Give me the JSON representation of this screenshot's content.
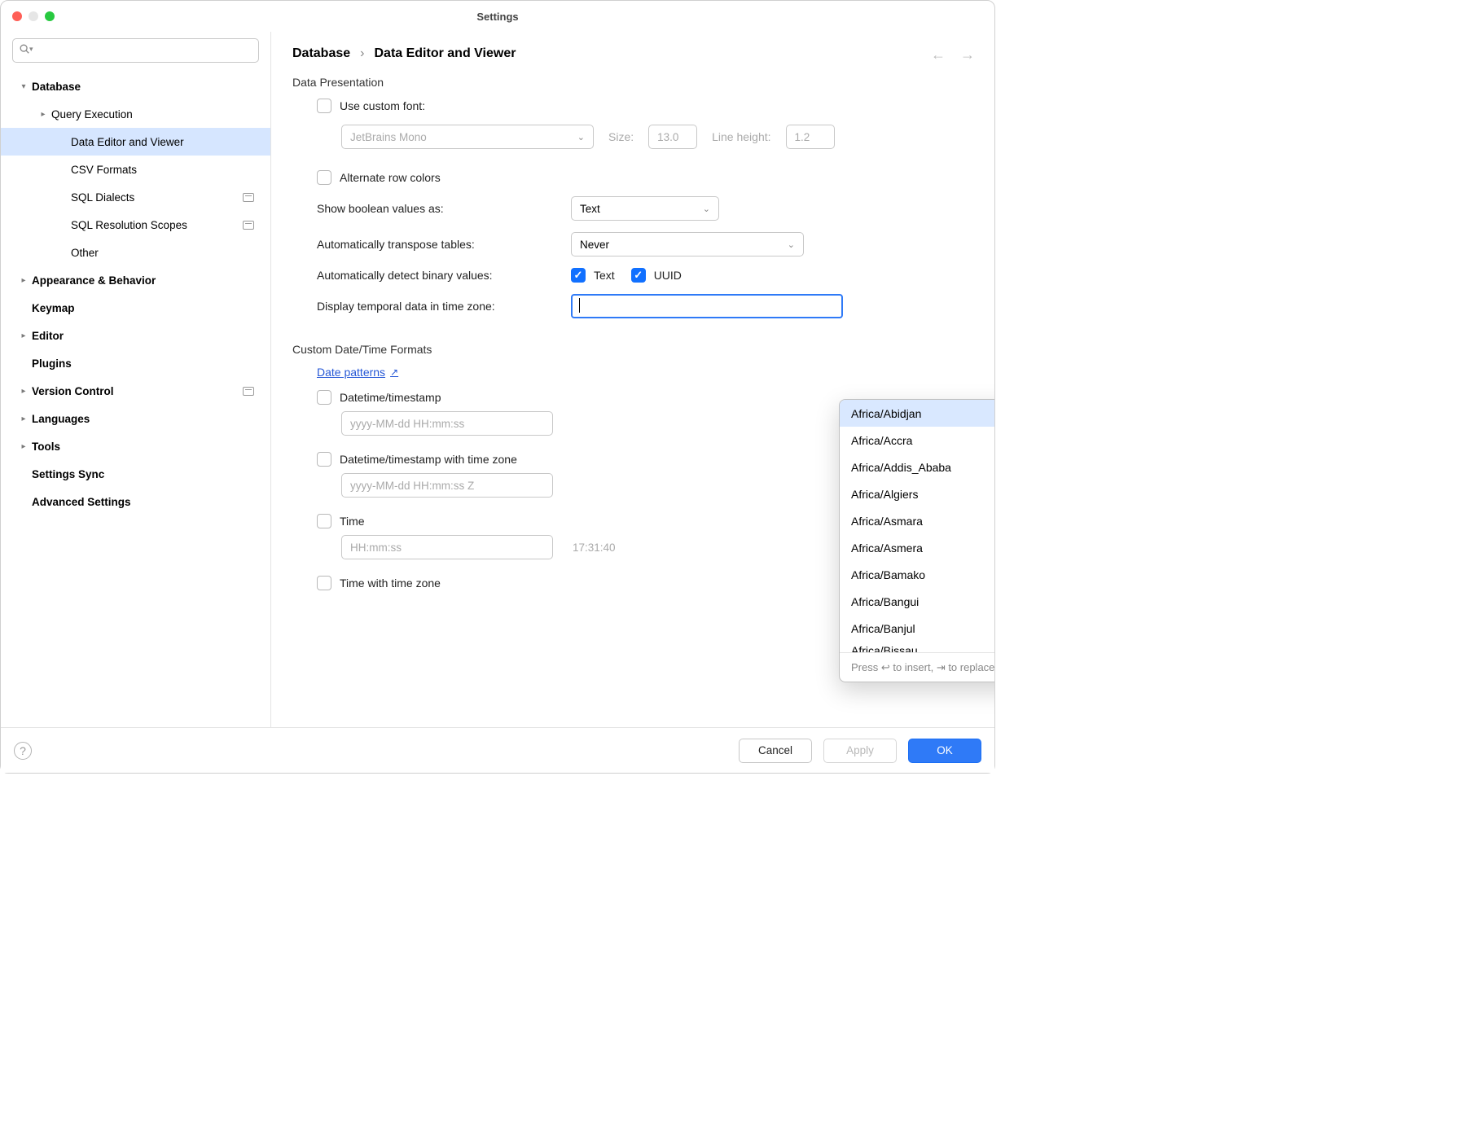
{
  "window": {
    "title": "Settings"
  },
  "search": {
    "placeholder": ""
  },
  "sidebar": {
    "items": [
      {
        "label": "Database",
        "bold": true,
        "arrow": "down",
        "indent": 0
      },
      {
        "label": "Query Execution",
        "arrow": "right",
        "indent": 1
      },
      {
        "label": "Data Editor and Viewer",
        "indent": 2,
        "selected": true
      },
      {
        "label": "CSV Formats",
        "indent": 2
      },
      {
        "label": "SQL Dialects",
        "indent": 2,
        "badge": true
      },
      {
        "label": "SQL Resolution Scopes",
        "indent": 2,
        "badge": true
      },
      {
        "label": "Other",
        "indent": 2
      },
      {
        "label": "Appearance & Behavior",
        "bold": true,
        "arrow": "right",
        "indent": 0
      },
      {
        "label": "Keymap",
        "bold": true,
        "indent": 0
      },
      {
        "label": "Editor",
        "bold": true,
        "arrow": "right",
        "indent": 0
      },
      {
        "label": "Plugins",
        "bold": true,
        "indent": 0
      },
      {
        "label": "Version Control",
        "bold": true,
        "arrow": "right",
        "indent": 0,
        "badge": true
      },
      {
        "label": "Languages",
        "bold": true,
        "arrow": "right",
        "indent": 0
      },
      {
        "label": "Tools",
        "bold": true,
        "arrow": "right",
        "indent": 0
      },
      {
        "label": "Settings Sync",
        "bold": true,
        "indent": 0
      },
      {
        "label": "Advanced Settings",
        "bold": true,
        "indent": 0
      }
    ]
  },
  "breadcrumb": {
    "root": "Database",
    "leaf": "Data Editor and Viewer"
  },
  "presentation": {
    "section": "Data Presentation",
    "use_custom_font_label": "Use custom font:",
    "font_name": "JetBrains Mono",
    "size_label": "Size:",
    "size_value": "13.0",
    "lineheight_label": "Line height:",
    "lineheight_value": "1.2",
    "alternate_rows_label": "Alternate row colors",
    "show_bool_label": "Show boolean values as:",
    "show_bool_value": "Text",
    "transpose_label": "Automatically transpose tables:",
    "transpose_value": "Never",
    "detect_binary_label": "Automatically detect binary values:",
    "detect_text_label": "Text",
    "detect_uuid_label": "UUID",
    "timezone_label": "Display temporal data in time zone:"
  },
  "dropdown": {
    "items": [
      "Africa/Abidjan",
      "Africa/Accra",
      "Africa/Addis_Ababa",
      "Africa/Algiers",
      "Africa/Asmara",
      "Africa/Asmera",
      "Africa/Bamako",
      "Africa/Bangui",
      "Africa/Banjul",
      "Africa/Bissau"
    ],
    "hint": "Press ↩ to insert, ⇥ to replace"
  },
  "formats": {
    "section": "Custom Date/Time Formats",
    "link_label": "Date patterns",
    "items": [
      {
        "label": "Datetime/timestamp",
        "placeholder": "yyyy-MM-dd HH:mm:ss",
        "preview": ""
      },
      {
        "label": "Datetime/timestamp with time zone",
        "placeholder": "yyyy-MM-dd HH:mm:ss Z",
        "preview": ""
      },
      {
        "label": "Time",
        "placeholder": "HH:mm:ss",
        "preview": "17:31:40"
      },
      {
        "label": "Time with time zone",
        "placeholder": "",
        "preview": ""
      }
    ]
  },
  "footer": {
    "cancel": "Cancel",
    "apply": "Apply",
    "ok": "OK"
  }
}
